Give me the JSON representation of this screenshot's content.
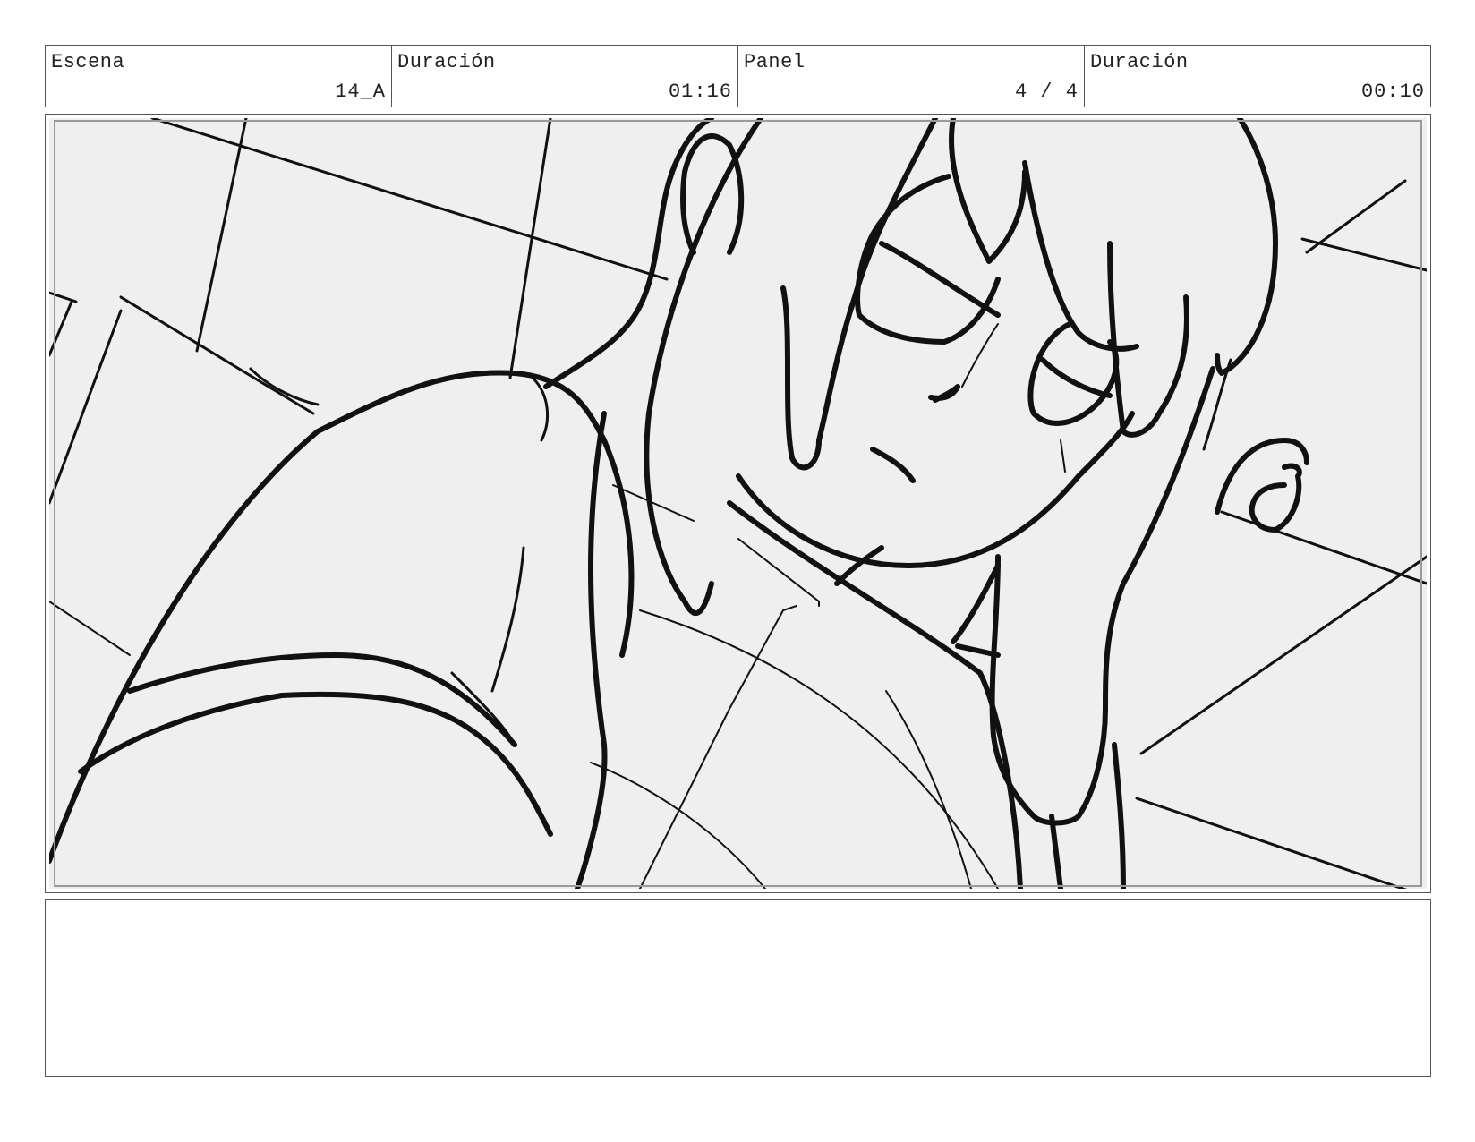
{
  "header": {
    "scene_label": "Escena",
    "scene_value": "14_A",
    "scene_duration_label": "Duración",
    "scene_duration_value": "01:16",
    "panel_label": "Panel",
    "panel_value": "4 / 4",
    "panel_duration_label": "Duración",
    "panel_duration_value": "00:10"
  },
  "panel": {
    "illustration": "storyboard-sketch",
    "background_color": "#efefef",
    "line_color": "#111111"
  },
  "notes": {
    "text": ""
  }
}
